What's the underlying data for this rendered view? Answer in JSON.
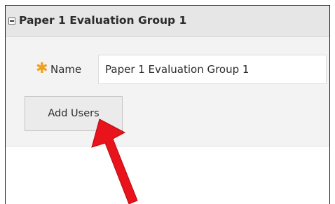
{
  "panel": {
    "title": "Paper 1 Evaluation Group 1",
    "collapse_icon": "minus-box-icon"
  },
  "form": {
    "name_label": "Name",
    "required_icon": "asterisk-icon",
    "required_color": "#f0a020",
    "name_value": "Paper 1 Evaluation Group 1",
    "add_users_label": "Add Users"
  },
  "annotation": {
    "icon": "red-arrow-icon",
    "color": "#e8131b"
  }
}
